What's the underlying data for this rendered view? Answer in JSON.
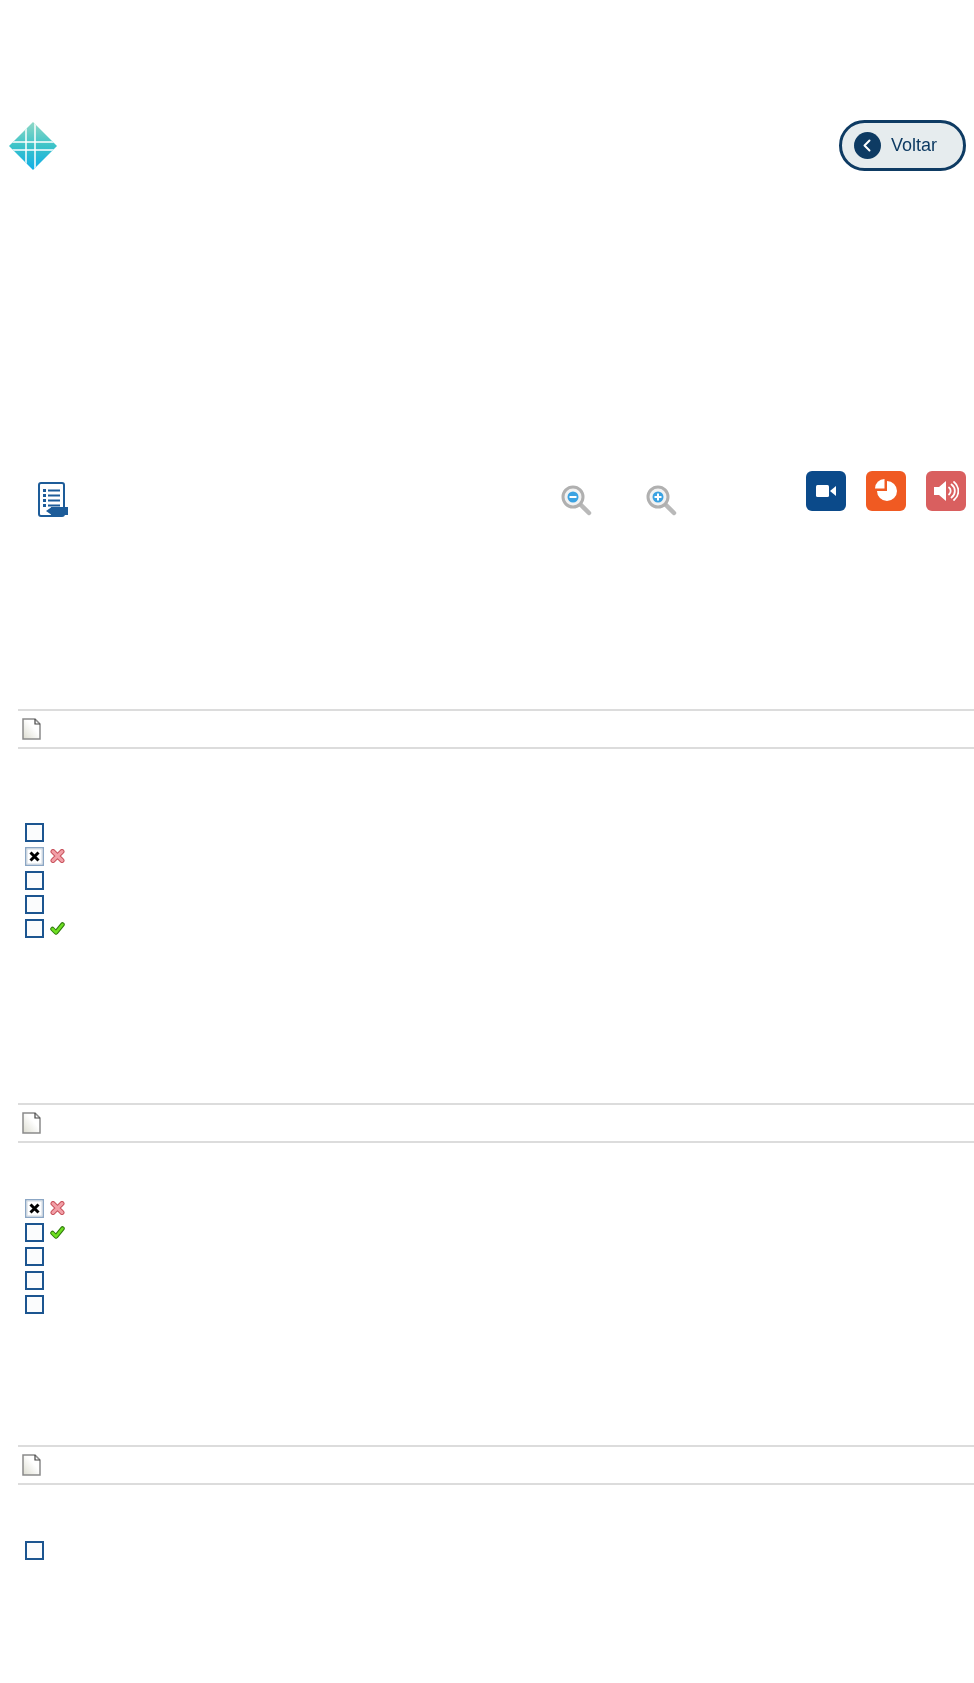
{
  "header": {
    "back_button": {
      "label": "Voltar"
    }
  },
  "questions": [
    {
      "options": [
        {
          "checked": false,
          "kind": "plain"
        },
        {
          "checked": true,
          "kind": "incorrect"
        },
        {
          "checked": false,
          "kind": "plain"
        },
        {
          "checked": false,
          "kind": "plain"
        },
        {
          "checked": false,
          "kind": "correct"
        }
      ]
    },
    {
      "options": [
        {
          "checked": true,
          "kind": "incorrect"
        },
        {
          "checked": false,
          "kind": "correct"
        },
        {
          "checked": false,
          "kind": "plain"
        },
        {
          "checked": false,
          "kind": "plain"
        },
        {
          "checked": false,
          "kind": "plain"
        }
      ]
    },
    {
      "options": [
        {
          "checked": false,
          "kind": "plain"
        }
      ]
    }
  ]
}
